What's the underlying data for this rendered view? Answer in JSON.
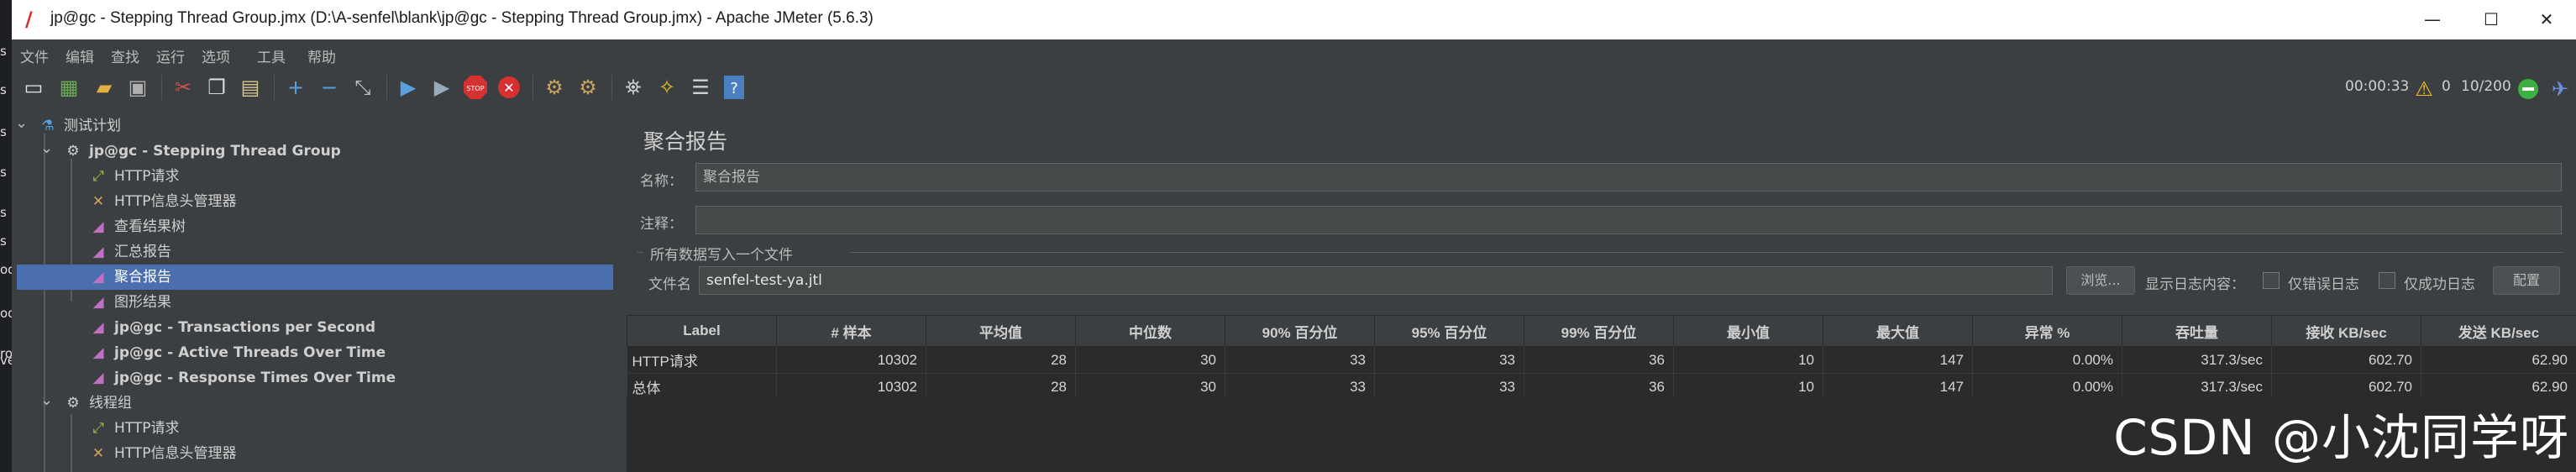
{
  "window": {
    "title": "jp@gc - Stepping Thread Group.jmx (D:\\A-senfel\\blank\\jp@gc - Stepping Thread Group.jmx) - Apache JMeter (5.6.3)"
  },
  "left_strip": [
    "s",
    "s",
    "s",
    "s",
    "s",
    "s",
    "od",
    "od",
    "ro",
    "ve"
  ],
  "menu": [
    "文件",
    "编辑",
    "查找",
    "运行",
    "选项",
    "工具",
    "帮助"
  ],
  "status": {
    "elapsed": "00:00:33",
    "warnings": "0",
    "threads": "10/200"
  },
  "tree": [
    {
      "label": "测试计划",
      "icon": "test-plan-icon"
    },
    {
      "label": "jp@gc - Stepping Thread Group",
      "icon": "thread-group-icon"
    },
    {
      "label": "HTTP请求",
      "icon": "http-sampler-icon"
    },
    {
      "label": "HTTP信息头管理器",
      "icon": "header-manager-icon"
    },
    {
      "label": "查看结果树",
      "icon": "listener-icon"
    },
    {
      "label": "汇总报告",
      "icon": "listener-icon"
    },
    {
      "label": "聚合报告",
      "icon": "listener-icon"
    },
    {
      "label": "图形结果",
      "icon": "listener-icon"
    },
    {
      "label": "jp@gc - Transactions per Second",
      "icon": "listener-icon"
    },
    {
      "label": "jp@gc - Active Threads Over Time",
      "icon": "listener-icon"
    },
    {
      "label": "jp@gc - Response Times Over Time",
      "icon": "listener-icon"
    },
    {
      "label": "线程组",
      "icon": "thread-group-icon"
    },
    {
      "label": "HTTP请求",
      "icon": "http-sampler-icon"
    },
    {
      "label": "HTTP信息头管理器",
      "icon": "header-manager-icon"
    }
  ],
  "panel": {
    "title": "聚合报告",
    "name_label": "名称：",
    "name_value": "聚合报告",
    "comment_label": "注释：",
    "comment_value": "",
    "group_title": "所有数据写入一个文件",
    "file_label": "文件名",
    "file_value": "senfel-test-ya.jtl",
    "browse_button": "浏览...",
    "log_label": "显示日志内容：",
    "errors_only": "仅错误日志",
    "success_only": "仅成功日志",
    "config_button": "配置"
  },
  "table": {
    "headers": [
      "Label",
      "# 样本",
      "平均值",
      "中位数",
      "90% 百分位",
      "95% 百分位",
      "99% 百分位",
      "最小值",
      "最大值",
      "异常 %",
      "吞吐量",
      "接收 KB/sec",
      "发送 KB/sec"
    ],
    "rows": [
      [
        "HTTP请求",
        "10302",
        "28",
        "30",
        "33",
        "33",
        "36",
        "10",
        "147",
        "0.00%",
        "317.3/sec",
        "602.70",
        "62.90"
      ],
      [
        "总体",
        "10302",
        "28",
        "30",
        "33",
        "33",
        "36",
        "10",
        "147",
        "0.00%",
        "317.3/sec",
        "602.70",
        "62.90"
      ]
    ]
  },
  "watermark": "CSDN @小沈同学呀"
}
